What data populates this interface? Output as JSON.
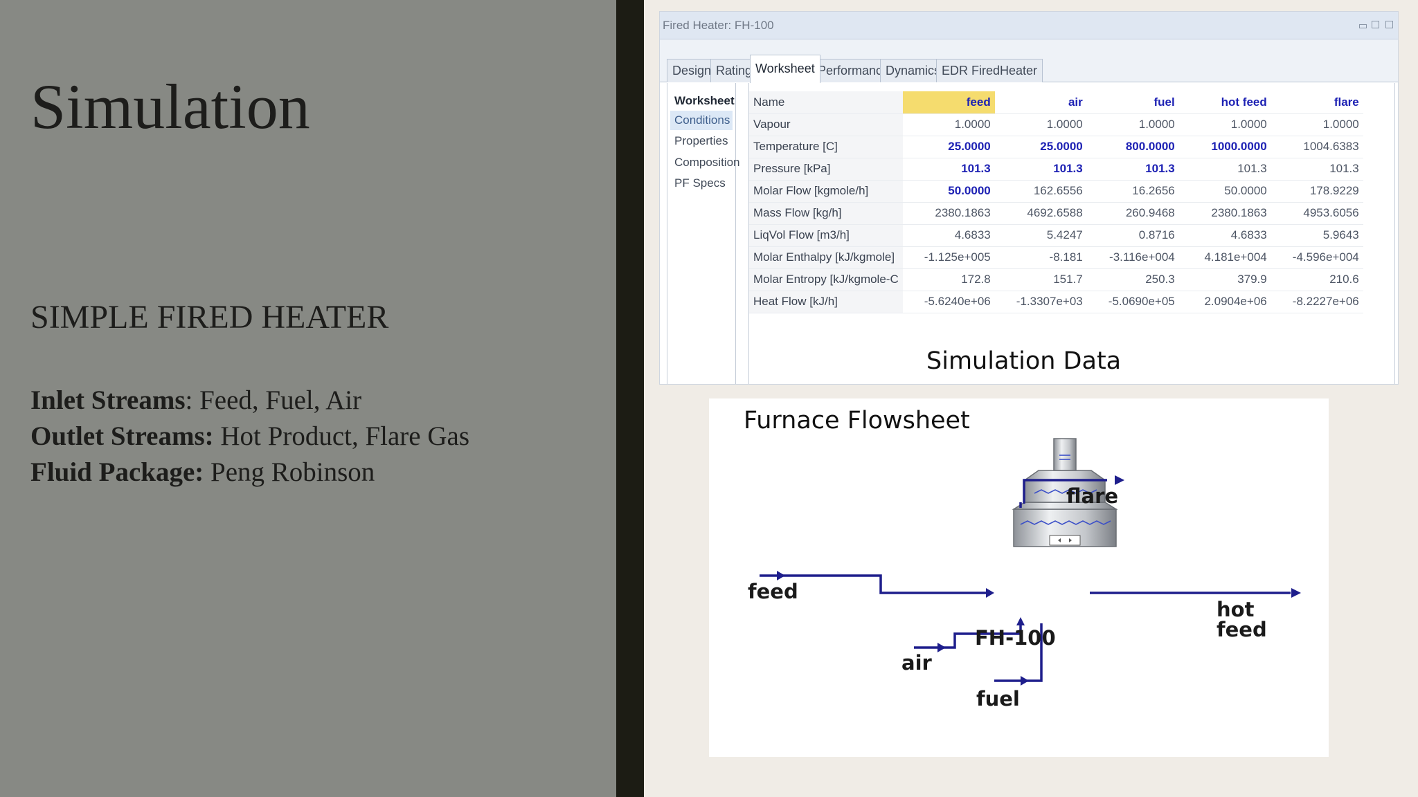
{
  "slide": {
    "title": "Simulation",
    "subtitle": "SIMPLE FIRED HEATER",
    "details": [
      {
        "label": "Inlet Streams",
        "value": ": Feed, Fuel, Air"
      },
      {
        "label": "Outlet Streams:",
        "value": " Hot Product, Flare Gas"
      },
      {
        "label": "Fluid Package:",
        "value": " Peng Robinson"
      }
    ]
  },
  "window": {
    "title": "Fired Heater: FH-100",
    "tabs": [
      "Design",
      "Rating",
      "Worksheet",
      "Performance",
      "Dynamics",
      "EDR FiredHeater"
    ],
    "active_tab": "Worksheet",
    "nav_header": "Worksheet",
    "nav_items": [
      "Conditions",
      "Properties",
      "Composition",
      "PF Specs"
    ],
    "active_nav": "Conditions",
    "table": {
      "name_label": "Name",
      "columns": [
        "feed",
        "air",
        "fuel",
        "hot feed",
        "flare"
      ],
      "rows": [
        {
          "label": "Vapour",
          "values": [
            "1.0000",
            "1.0000",
            "1.0000",
            "1.0000",
            "1.0000"
          ],
          "specified": [
            false,
            false,
            false,
            false,
            false
          ]
        },
        {
          "label": "Temperature [C]",
          "values": [
            "25.0000",
            "25.0000",
            "800.0000",
            "1000.0000",
            "1004.6383"
          ],
          "specified": [
            true,
            true,
            true,
            true,
            false
          ]
        },
        {
          "label": "Pressure [kPa]",
          "values": [
            "101.3",
            "101.3",
            "101.3",
            "101.3",
            "101.3"
          ],
          "specified": [
            true,
            true,
            true,
            false,
            false
          ]
        },
        {
          "label": "Molar Flow [kgmole/h]",
          "values": [
            "50.0000",
            "162.6556",
            "16.2656",
            "50.0000",
            "178.9229"
          ],
          "specified": [
            true,
            false,
            false,
            false,
            false
          ]
        },
        {
          "label": "Mass Flow [kg/h]",
          "values": [
            "2380.1863",
            "4692.6588",
            "260.9468",
            "2380.1863",
            "4953.6056"
          ],
          "specified": [
            false,
            false,
            false,
            false,
            false
          ]
        },
        {
          "label": "LiqVol Flow [m3/h]",
          "values": [
            "4.6833",
            "5.4247",
            "0.8716",
            "4.6833",
            "5.9643"
          ],
          "specified": [
            false,
            false,
            false,
            false,
            false
          ]
        },
        {
          "label": "Molar Enthalpy [kJ/kgmole]",
          "values": [
            "-1.125e+005",
            "-8.181",
            "-3.116e+004",
            "4.181e+004",
            "-4.596e+004"
          ],
          "specified": [
            false,
            false,
            false,
            false,
            false
          ]
        },
        {
          "label": "Molar Entropy [kJ/kgmole-C",
          "values": [
            "172.8",
            "151.7",
            "250.3",
            "379.9",
            "210.6"
          ],
          "specified": [
            false,
            false,
            false,
            false,
            false
          ]
        },
        {
          "label": "Heat Flow [kJ/h]",
          "values": [
            "-5.6240e+06",
            "-1.3307e+03",
            "-5.0690e+05",
            "2.0904e+06",
            "-8.2227e+06"
          ],
          "specified": [
            false,
            false,
            false,
            false,
            false
          ]
        }
      ]
    }
  },
  "caption": "Simulation Data",
  "flowsheet": {
    "title": "Furnace Flowsheet",
    "unit_label": "FH-100",
    "streams": {
      "feed": "feed",
      "flare": "flare",
      "hot_feed_line1": "hot",
      "hot_feed_line2": "feed",
      "air": "air",
      "fuel": "fuel"
    }
  },
  "colors": {
    "left_panel": "#878984",
    "divider": "#1c1c14",
    "stream_line": "#1e1e8c",
    "specified_value": "#1e22b4",
    "highlight": "#f5dc6e"
  }
}
